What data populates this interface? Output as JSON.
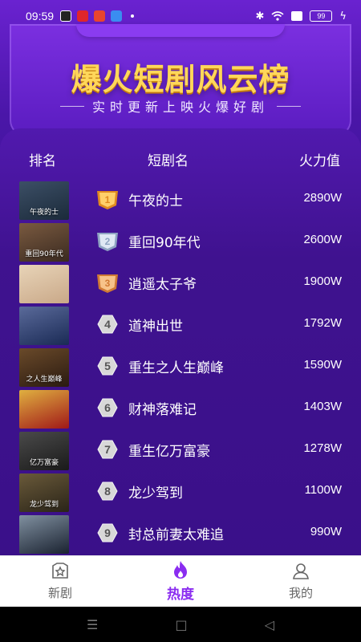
{
  "status_bar": {
    "time": "09:59",
    "battery": "99",
    "apps": [
      {
        "icon": "tiktok-icon",
        "color": "#222222"
      },
      {
        "icon": "weibo-icon",
        "color": "#e0262b"
      },
      {
        "icon": "video-app-icon",
        "color": "#e8452f"
      },
      {
        "icon": "browser-icon",
        "color": "#3a8df0"
      }
    ]
  },
  "header": {
    "title": "爆火短剧风云榜",
    "subtitle": "实时更新上映火爆好剧",
    "title_color": "#ffd75a"
  },
  "table": {
    "columns": {
      "rank": "排名",
      "name": "短剧名",
      "heat": "火力值"
    },
    "rows": [
      {
        "rank": "1",
        "name": "午夜的士",
        "heat": "2890W",
        "poster_text": "午夜的士",
        "medal": "gold"
      },
      {
        "rank": "2",
        "name": "重回90年代",
        "heat": "2600W",
        "poster_text": "重回90年代",
        "medal": "silver"
      },
      {
        "rank": "3",
        "name": "逍遥太子爷",
        "heat": "1900W",
        "poster_text": "",
        "medal": "bronze"
      },
      {
        "rank": "4",
        "name": "道神出世",
        "heat": "1792W",
        "poster_text": "",
        "medal": "none"
      },
      {
        "rank": "5",
        "name": "重生之人生巅峰",
        "heat": "1590W",
        "poster_text": "之人生巅峰",
        "medal": "none"
      },
      {
        "rank": "6",
        "name": "财神落难记",
        "heat": "1403W",
        "poster_text": "",
        "medal": "none"
      },
      {
        "rank": "7",
        "name": "重生亿万富豪",
        "heat": "1278W",
        "poster_text": "亿万富豪",
        "medal": "none"
      },
      {
        "rank": "8",
        "name": "龙少驾到",
        "heat": "1100W",
        "poster_text": "龙少驾到",
        "medal": "none"
      },
      {
        "rank": "9",
        "name": "封总前妻太难追",
        "heat": "990W",
        "poster_text": "",
        "medal": "none"
      }
    ]
  },
  "tab_bar": {
    "tabs": [
      {
        "label": "新剧",
        "icon": "star-icon"
      },
      {
        "label": "热度",
        "icon": "flame-icon"
      },
      {
        "label": "我的",
        "icon": "profile-icon"
      }
    ],
    "active": "热度",
    "accent": "#8a2cf0"
  },
  "nav_bar": {
    "menu": "☰",
    "home": "□",
    "back": "◁"
  }
}
